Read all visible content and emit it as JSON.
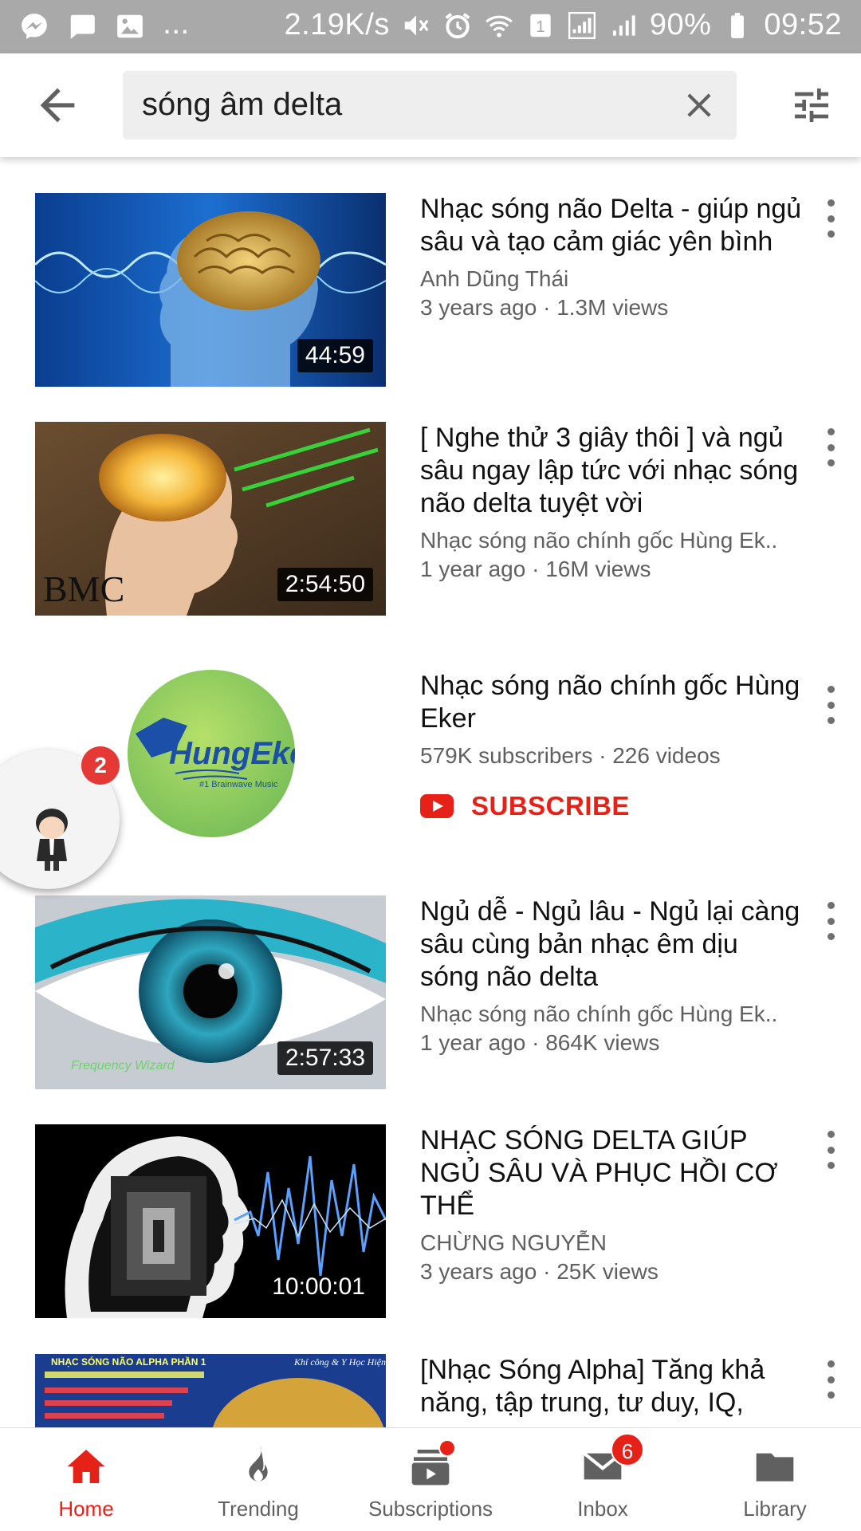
{
  "status_bar": {
    "speed": "2.19K/s",
    "battery": "90%",
    "time": "09:52",
    "dots": "...",
    "sim": "1"
  },
  "search": {
    "query": "sóng âm delta"
  },
  "results": [
    {
      "title": "Nhạc sóng não Delta - giúp ngủ sâu và tạo cảm giác yên bình",
      "channel": "Anh Dũng Thái",
      "meta": "3 years ago · 1.3M views",
      "duration": "44:59"
    },
    {
      "title": "[ Nghe thử 3 giây thôi ] và ngủ sâu ngay lập tức với nhạc sóng não delta tuyệt vời",
      "channel": "Nhạc sóng não chính gốc Hùng Ek..",
      "meta": "1 year ago · 16M views",
      "duration": "2:54:50",
      "thumb_text": "BMC"
    },
    {
      "title": "Ngủ dễ - Ngủ lâu - Ngủ lại càng sâu cùng bản nhạc êm dịu sóng não delta",
      "channel": "Nhạc sóng não chính gốc Hùng Ek..",
      "meta": "1 year ago · 864K views",
      "duration": "2:57:33",
      "thumb_text": "Frequency Wizard"
    },
    {
      "title": "NHẠC SÓNG DELTA   GIÚP NGỦ SÂU VÀ PHỤC HỒI CƠ THỂ",
      "channel": "CHỪNG NGUYỄN",
      "meta": "3 years ago · 25K views",
      "duration": "10:00:01"
    },
    {
      "title": "[Nhạc Sóng Alpha] Tăng khả năng, tập trung, tư duy, IQ,",
      "thumb_text_1": "NHẠC SÓNG NÃO ALPHA PHẦN 1",
      "thumb_text_2": "Khí công & Y Học Hiện Đại"
    }
  ],
  "channel": {
    "name": "Nhạc sóng não chính gốc Hùng Eker",
    "meta": "579K subscribers · 226 videos",
    "subscribe_label": "SUBSCRIBE",
    "logo_text": "HungEker",
    "logo_subtext": "#1 Brainwave Music"
  },
  "chat_head": {
    "badge": "2"
  },
  "bottom_nav": {
    "items": [
      {
        "label": "Home",
        "icon": "home-icon"
      },
      {
        "label": "Trending",
        "icon": "flame-icon"
      },
      {
        "label": "Subscriptions",
        "icon": "subscriptions-icon"
      },
      {
        "label": "Inbox",
        "icon": "mail-icon",
        "badge": "6"
      },
      {
        "label": "Library",
        "icon": "folder-icon"
      }
    ]
  },
  "colors": {
    "accent": "#e62117",
    "status_bar": "#a9a9a9",
    "meta_text": "#606060"
  }
}
